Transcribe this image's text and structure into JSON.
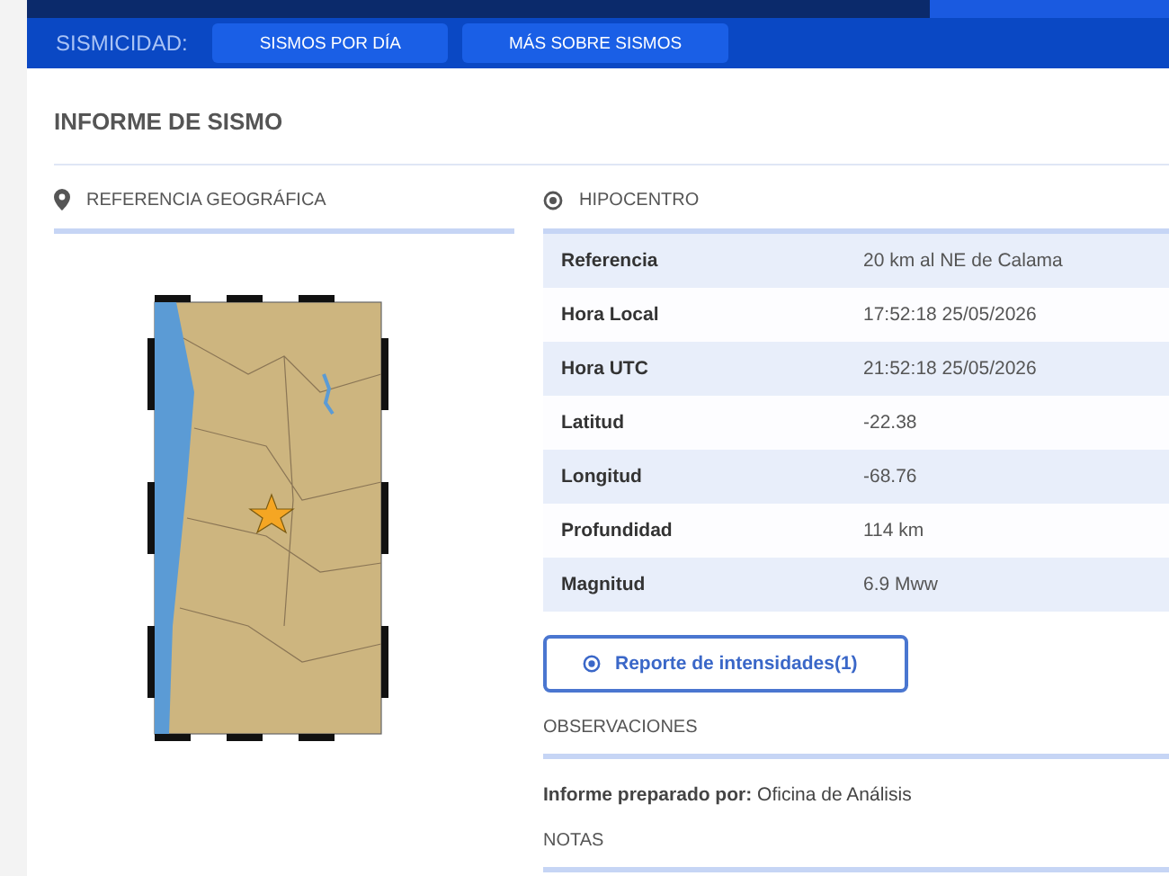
{
  "nav": {
    "label": "SISMICIDAD:",
    "buttons": [
      "SISMOS POR DÍA",
      "MÁS SOBRE SISMOS"
    ]
  },
  "title": "INFORME DE SISMO",
  "map_panel": {
    "heading": "REFERENCIA GEOGRÁFICA"
  },
  "hypocenter": {
    "heading": "HIPOCENTRO",
    "rows": [
      {
        "label": "Referencia",
        "value": "20 km al NE de Calama"
      },
      {
        "label": "Hora Local",
        "value": "17:52:18 25/05/2026"
      },
      {
        "label": "Hora UTC",
        "value": "21:52:18 25/05/2026"
      },
      {
        "label": "Latitud",
        "value": "-22.38"
      },
      {
        "label": "Longitud",
        "value": "-68.76"
      },
      {
        "label": "Profundidad",
        "value": "114 km"
      },
      {
        "label": "Magnitud",
        "value": "6.9 Mww"
      }
    ]
  },
  "report_button": "Reporte de intensidades(1)",
  "observations": {
    "heading": "OBSERVACIONES",
    "text": "**Informe preparado por:** Oficina de Análisis"
  },
  "notes": {
    "heading": "NOTAS"
  }
}
